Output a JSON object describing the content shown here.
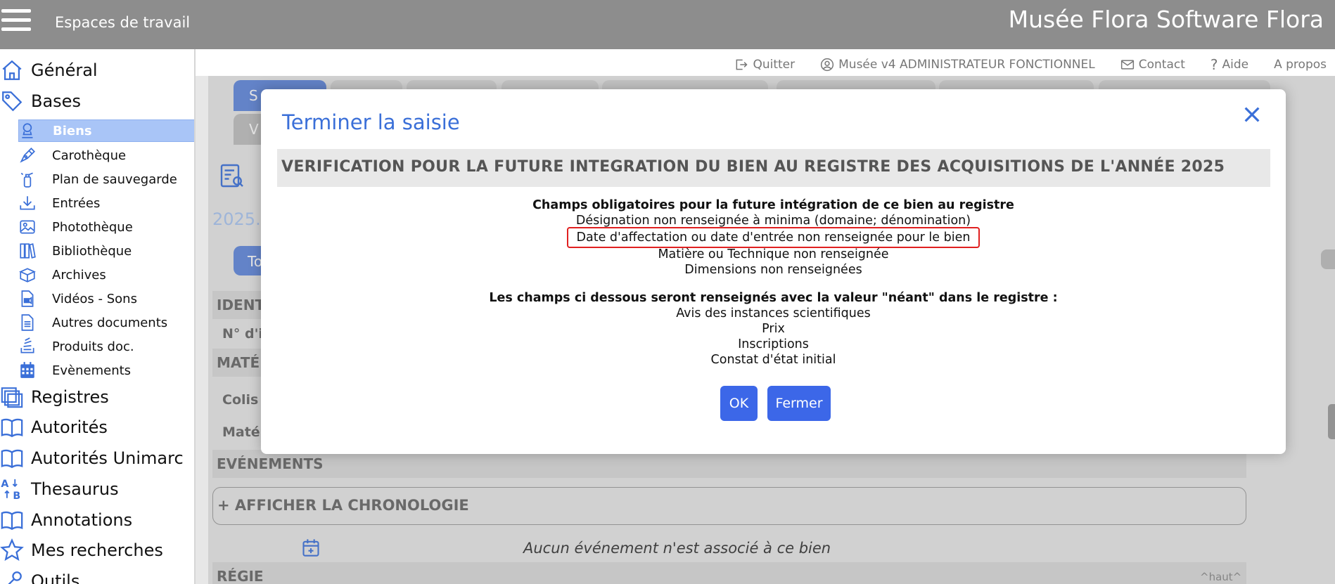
{
  "header": {
    "workspaces_label": "Espaces de travail",
    "app_title": "Musée Flora Software Flora"
  },
  "sidebar": {
    "top_items": [
      {
        "label": "Général",
        "icon": "home-icon"
      },
      {
        "label": "Bases",
        "icon": "tag-icon"
      }
    ],
    "sub_items": [
      {
        "label": "Biens",
        "icon": "bust-icon",
        "active": true
      },
      {
        "label": "Carothèque",
        "icon": "pen-icon"
      },
      {
        "label": "Plan de sauvegarde",
        "icon": "extinguisher-icon"
      },
      {
        "label": "Entrées",
        "icon": "download-icon"
      },
      {
        "label": "Photothèque",
        "icon": "image-icon"
      },
      {
        "label": "Bibliothèque",
        "icon": "books-icon"
      },
      {
        "label": "Archives",
        "icon": "box-icon"
      },
      {
        "label": "Vidéos - Sons",
        "icon": "video-file-icon"
      },
      {
        "label": "Autres documents",
        "icon": "document-icon"
      },
      {
        "label": "Produits doc.",
        "icon": "stack-icon"
      },
      {
        "label": "Evènements",
        "icon": "calendar-icon"
      }
    ],
    "bottom_items": [
      {
        "label": "Registres",
        "icon": "registers-icon"
      },
      {
        "label": "Autorités",
        "icon": "open-book-icon"
      },
      {
        "label": "Autorités Unimarc",
        "icon": "open-book-icon"
      },
      {
        "label": "Thesaurus",
        "icon": "sort-az-icon"
      },
      {
        "label": "Annotations",
        "icon": "open-book-icon"
      },
      {
        "label": "Mes recherches",
        "icon": "star-icon"
      },
      {
        "label": "Outils",
        "icon": "tools-icon"
      }
    ]
  },
  "toplinks": {
    "quit": "Quitter",
    "user": "Musée v4 ADMINISTRATEUR FONCTIONNEL",
    "contact": "Contact",
    "help": "Aide",
    "about": "A propos"
  },
  "background": {
    "tab_s": "S",
    "tab_v": "V",
    "tab_to": "To",
    "year": "2025.",
    "section_ident": "IDENT",
    "field_no": "N° d'in",
    "section_mate": "MATÉ",
    "field_colis": "Colis",
    "field_materi": "Matéri",
    "section_events": "EVÉNEMENTS",
    "chronology": "+ AFFICHER LA CHRONOLOGIE",
    "no_event": "Aucun événement n'est associé à ce bien",
    "section_regie": "RÉGIE",
    "haut": "^haut^"
  },
  "modal": {
    "title": "Terminer la saisie",
    "verification_heading": "VERIFICATION POUR LA FUTURE INTEGRATION DU BIEN AU REGISTRE DES ACQUISITIONS DE L'ANNÉE 2025",
    "mandatory_heading": "Champs obligatoires pour la future intégration de ce bien au registre",
    "mandatory_items": [
      "Désignation non renseignée à minima (domaine; dénomination)",
      "Date d'affectation ou date d'entrée non renseignée pour le bien",
      "Matière ou Technique non renseignée",
      "Dimensions non renseignées"
    ],
    "neant_heading": "Les champs ci dessous seront renseignés avec la valeur \"néant\" dans le registre :",
    "neant_items": [
      "Avis des instances scientifiques",
      "Prix",
      "Inscriptions",
      "Constat d'état initial"
    ],
    "ok_label": "OK",
    "close_label": "Fermer"
  },
  "colors": {
    "accent": "#3a6fd8",
    "button": "#3c67e8",
    "topbar": "#8d8d8d",
    "highlight_border": "#e02020",
    "active_item": "#a9c5f7"
  }
}
